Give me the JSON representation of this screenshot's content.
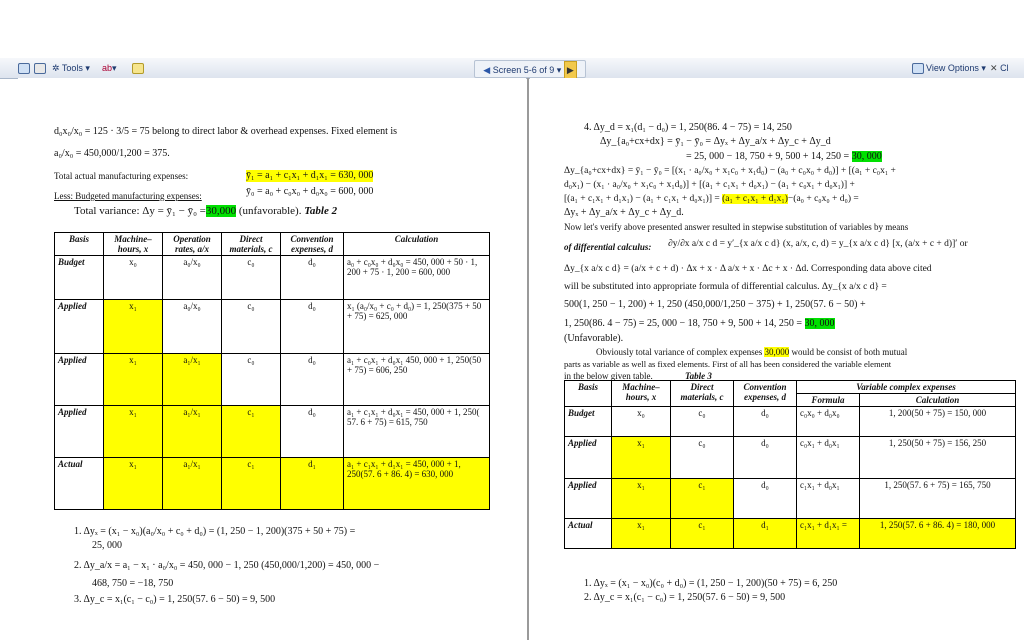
{
  "toolbar": {
    "tools": "Tools",
    "screen": "Screen 5-6 of 9",
    "view_options": "View Options",
    "close": "Cl"
  },
  "left": {
    "eq1": "d₀x₀/x₀ = 125 · 3/5 = 75  belong to direct labor & overhead expenses. Fixed element is",
    "eq2": "a₀/x₀ = 450,000/1,200 = 375.",
    "actual_label": "Total actual manufacturing expenses:",
    "actual_eq": "ȳ₁ = a₁ + c₁x₁ + d₁x₁ = 630, 000",
    "budget_label": "Less: Budgeted manufacturing expenses:",
    "budget_eq": "ȳ₀ = a₀ + c₀x₀ + d₀x₀ = 600, 000",
    "variance_label": "Total variance:  Δy = ȳ₁ − ȳ₀ =",
    "variance_value": "30,000",
    "variance_tail": "(unfavorable).",
    "table_title": "Table 2",
    "table": {
      "headers": [
        "Basis",
        "Machine–hours, x",
        "Operation rates, a/x",
        "Direct materials, c",
        "Convention expenses, d",
        "Calculation"
      ],
      "rows": [
        {
          "basis": "Budget",
          "x": "x₀",
          "rate": "a₀/x₀",
          "c": "c₀",
          "d": "d₀",
          "calc": "a₀ + c₀x₀ + d₀x₀ = 450, 000 + 50 · 1, 200 + 75 · 1, 200 = 600, 000"
        },
        {
          "basis": "Applied",
          "x": "x₁",
          "rate": "a₀/x₀",
          "c": "c₀",
          "d": "d₀",
          "calc": "x₁ (a₀/x₀ + c₀ + d₀) = 1, 250(375 + 50 + 75) = 625, 000"
        },
        {
          "basis": "Applied",
          "x": "x₁",
          "rate": "a₁/x₁",
          "c": "c₀",
          "d": "d₀",
          "calc": "a₁ + c₀x₁ + d₀x₁ 450, 000 + 1, 250(50 + 75) = 606, 250"
        },
        {
          "basis": "Applied",
          "x": "x₁",
          "rate": "a₁/x₁",
          "c": "c₁",
          "d": "d₀",
          "calc": "a₁ + c₁x₁ + d₀x₁ = 450, 000 + 1, 250( 57. 6 + 75) = 615, 750"
        },
        {
          "basis": "Actual",
          "x": "x₁",
          "rate": "a₁/x₁",
          "c": "c₁",
          "d": "d₁",
          "calc": "a₁ + c₁x₁ + d₁x₁ = 450, 000 + 1, 250(57. 6 + 86. 4) = 630, 000"
        }
      ]
    },
    "list": [
      "1.  Δyₓ = (x₁ − x₀)(a₀/x₀ + c₀ + d₀) = (1, 250 − 1, 200)(375 + 50 + 75) =",
      "25, 000",
      "2.  Δy_a/x = a₁ − x₁ · a₀/x₀ = 450, 000 − 1, 250 (450,000/1,200) = 450, 000 −",
      "468, 750 = −18, 750",
      "3.  Δy_c = x₁(c₁ − c₀) = 1, 250(57. 6 − 50) = 9, 500"
    ]
  },
  "right": {
    "lines": [
      "4.  Δy_d = x₁(d₁ − d₀) = 1, 250(86. 4 − 75) = 14, 250",
      "Δy_{a₀+cx+dx} = ȳ₁ − ȳ₀ = Δyₓ + Δy_a/x + Δy_c + Δy_d",
      "= 25, 000 − 18, 750 + 9, 500 + 14, 250 =",
      "Δy_{a₀+cx+dx} = ȳ₁ − ȳ₀ = [(x₁ · a₀/x₀ + x₁c₀ + x₁d₀) − (a₀ + c₀x₀ + d₀)] + [(a₁ + c₀x₁ +",
      "d₀x₁) − (x₁ · a₀/x₀ + x₁c₀ + x₁d₀)] + [(a₁ + c₁x₁ + d₀x₁) − (a₁ + c₀x₁ + d₀x₁)] +",
      "[(a₁ + c₁x₁ + d₁x₁) − (a₁ + c₁x₁ + d₀x₁)] =",
      "(a₁ + c₁x₁ + d₁x₁)",
      "−(a₀ + c₀x₀ + d₀) =",
      "Δyₓ + Δy_a/x + Δy_c + Δy_d.",
      "Now let's verify above presented answer resulted in stepwise substitution of variables by means",
      "of differential calculus:",
      "∂y/∂x a/x c d = y′_{x a/x c d} (x, a/x, c, d) = y_{x a/x c d} [x, (a/x + c + d)]′  or",
      "Δy_{x a/x c d} = (a/x + c + d) · Δx + x · Δ a/x + x · Δc + x · Δd. Corresponding data above cited",
      "will be substituted into appropriate formula of differential calculus. Δy_{x a/x c d} =",
      "500(1, 250 − 1, 200) + 1, 250 (450,000/1,250 − 375) + 1, 250(57. 6 − 50) +",
      "1, 250(86. 4 − 75) = 25, 000 − 18, 750 + 9, 500 + 14, 250 =",
      "(Unfavorable).",
      "Obviously total variance of complex expenses",
      "would be consist of both mutual",
      "parts as variable as well as fixed elements.  First of all has been considered the variable element",
      "in the below given table."
    ],
    "green_value": "30, 000",
    "yellow_value": "30,000",
    "table_title": "Table 3",
    "table": {
      "headers": [
        "Basis",
        "Machine–hours, x",
        "Direct materials, c",
        "Convention expenses, d",
        "Variable complex expenses",
        "Formula",
        "Calculation"
      ],
      "rows": [
        {
          "basis": "Budget",
          "x": "x₀",
          "c": "c₀",
          "d": "d₀",
          "formula": "c₀x₀ + d₀x₀",
          "calc": "1, 200(50 + 75) = 150, 000"
        },
        {
          "basis": "Applied",
          "x": "x₁",
          "c": "c₀",
          "d": "d₀",
          "formula": "c₀x₁ + d₀x₁",
          "calc": "1, 250(50 + 75) = 156, 250"
        },
        {
          "basis": "Applied",
          "x": "x₁",
          "c": "c₁",
          "d": "d₀",
          "formula": "c₁x₁ + d₀x₁",
          "calc": "1, 250(57. 6 + 75) = 165, 750"
        },
        {
          "basis": "Actual",
          "x": "x₁",
          "c": "c₁",
          "d": "d₁",
          "formula": "c₁x₁ + d₁x₁ =",
          "calc": "1, 250(57. 6 + 86. 4) = 180, 000"
        }
      ]
    },
    "list": [
      "1.  Δyₓ = (x₁ − x₀)(c₀ + d₀) = (1, 250 − 1, 200)(50 + 75) = 6, 250",
      "2.  Δy_c = x₁(c₁ − c₀) = 1, 250(57. 6 − 50) = 9, 500"
    ]
  }
}
